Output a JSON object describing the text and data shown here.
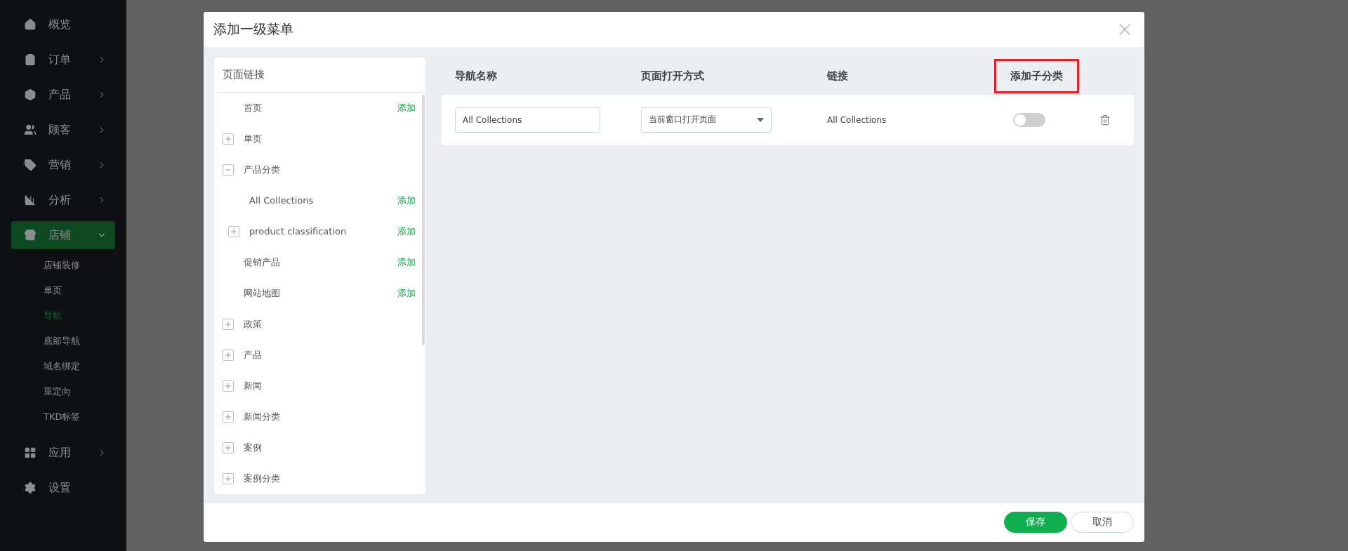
{
  "sidebar": {
    "items": [
      {
        "label": "概览",
        "has_submenu": false,
        "selected": false
      },
      {
        "label": "订单",
        "has_submenu": true,
        "expanded": false,
        "selected": false
      },
      {
        "label": "产品",
        "has_submenu": true,
        "expanded": false,
        "selected": false
      },
      {
        "label": "顾客",
        "has_submenu": true,
        "expanded": false,
        "selected": false
      },
      {
        "label": "营销",
        "has_submenu": true,
        "expanded": false,
        "selected": false
      },
      {
        "label": "分析",
        "has_submenu": true,
        "expanded": false,
        "selected": false
      },
      {
        "label": "店铺",
        "has_submenu": true,
        "expanded": true,
        "selected": true,
        "children": [
          {
            "label": "店铺装修",
            "selected": false
          },
          {
            "label": "单页",
            "selected": false
          },
          {
            "label": "导航",
            "selected": true
          },
          {
            "label": "底部导航",
            "selected": false
          },
          {
            "label": "域名绑定",
            "selected": false
          },
          {
            "label": "重定向",
            "selected": false
          },
          {
            "label": "TKD标签",
            "selected": false
          }
        ]
      },
      {
        "label": "应用",
        "has_submenu": true,
        "expanded": false,
        "selected": false
      },
      {
        "label": "设置",
        "has_submenu": false,
        "selected": false
      }
    ]
  },
  "dialog": {
    "title": "添加一级菜单",
    "page_links": {
      "title": "页面链接",
      "items": [
        {
          "kind": "leaf",
          "label": "首页",
          "add": "添加"
        },
        {
          "kind": "folder",
          "label": "单页",
          "expanded": false
        },
        {
          "kind": "folder",
          "label": "产品分类",
          "expanded": true,
          "children": [
            {
              "kind": "leaf",
              "label": "All Collections",
              "add": "添加"
            },
            {
              "kind": "folder",
              "label": "product classification",
              "expanded": false,
              "add": "添加"
            }
          ]
        },
        {
          "kind": "leaf",
          "label": "促销产品",
          "add": "添加"
        },
        {
          "kind": "leaf",
          "label": "网站地图",
          "add": "添加"
        },
        {
          "kind": "folder",
          "label": "政策",
          "expanded": false
        },
        {
          "kind": "folder",
          "label": "产品",
          "expanded": false
        },
        {
          "kind": "folder",
          "label": "新闻",
          "expanded": false
        },
        {
          "kind": "folder",
          "label": "新闻分类",
          "expanded": false
        },
        {
          "kind": "folder",
          "label": "案例",
          "expanded": false
        },
        {
          "kind": "folder",
          "label": "案例分类",
          "expanded": false
        }
      ]
    },
    "table": {
      "columns": [
        {
          "label": "导航名称",
          "highlighted": false
        },
        {
          "label": "页面打开方式",
          "highlighted": false
        },
        {
          "label": "链接",
          "highlighted": false
        },
        {
          "label": "添加子分类",
          "highlighted": true
        }
      ],
      "rows": [
        {
          "name": "All Collections",
          "open_mode": "当前窗口打开页面",
          "link": "All Collections",
          "subcategory_on": false
        }
      ]
    },
    "buttons": [
      {
        "kind": "primary",
        "label": "保存"
      },
      {
        "kind": "secondary",
        "label": "取消"
      }
    ]
  }
}
